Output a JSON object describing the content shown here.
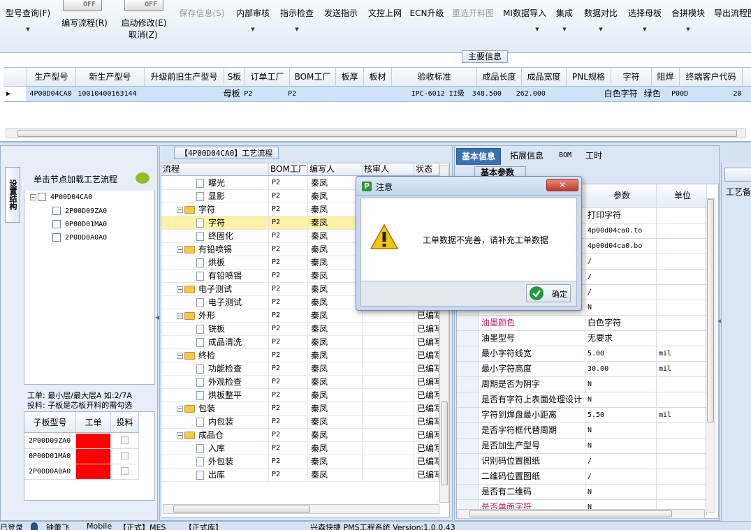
{
  "toolbar": {
    "buttons": [
      {
        "label": "型号查询(F)",
        "dropdown": true
      },
      {
        "label": "编写流程(R)"
      },
      {
        "label": "启动修改(E)"
      },
      {
        "label": "保存信息(S)",
        "disabled": true
      },
      {
        "label": "内部审核",
        "dropdown": true
      },
      {
        "label": "指示检查",
        "dropdown": true
      },
      {
        "label": "发送指示"
      },
      {
        "label": "文控上网"
      },
      {
        "label": "ECN升级"
      },
      {
        "label": "重选开料图",
        "disabled": true
      },
      {
        "label": "MI数据导入",
        "dropdown": true
      },
      {
        "label": "集成",
        "dropdown": true
      },
      {
        "label": "数据对比",
        "dropdown": true
      },
      {
        "label": "选择母板",
        "dropdown": true
      },
      {
        "label": "合拼模块",
        "dropdown": true
      },
      {
        "label": "导出流程图"
      }
    ],
    "toggle_off": "OFF",
    "cancel_label": "取消(Z)"
  },
  "main_info": {
    "caption": "主要信息",
    "columns": [
      "生产型号",
      "新生产型号",
      "升级前旧生产型号",
      "S板",
      "订单工厂",
      "BOM工厂",
      "板厚",
      "板材",
      "验收标准",
      "成品长度",
      "成品宽度",
      "PNL规格",
      "字符",
      "阻焊",
      "终端客户代码"
    ],
    "row": [
      "4P00D04CA0",
      "10010400163144",
      "",
      "母板",
      "P2",
      "P2",
      "",
      "",
      "IPC-6012 II级",
      "348.500",
      "262.000",
      "",
      "白色字符",
      "绿色",
      "P00D"
    ],
    "row_extra": "20"
  },
  "left": {
    "vtab_label": "设置结构",
    "tree_header": "单击节点加载工艺流程",
    "tree": {
      "root": "4P00D04CA0",
      "children": [
        "2P00D09ZA0",
        "0P00D01MA0",
        "2P00D0A0A0"
      ]
    },
    "note1": "工单: 最小层/最大层A 如:2/7A",
    "note2": "投料: 子板是芯板开料的需勾选",
    "sub_grid": {
      "headers": [
        "子板型号",
        "工单",
        "投料"
      ],
      "rows": [
        "2P00D09ZA0",
        "0P00D01MA0",
        "2P00D0A0A0"
      ]
    }
  },
  "process": {
    "caption": "【4P00D04CA0】工艺流程",
    "headers": [
      "流程",
      "BOM工厂",
      "编写人",
      "核审人",
      "状态"
    ],
    "rows": [
      {
        "name": "曝光",
        "level": 2,
        "bom": "P2",
        "writer": "秦凤",
        "status": ""
      },
      {
        "name": "显影",
        "level": 2,
        "bom": "P2",
        "writer": "秦凤",
        "status": ""
      },
      {
        "name": "字符",
        "level": 1,
        "bom": "P2",
        "writer": "秦凤",
        "status": ""
      },
      {
        "name": "字符",
        "level": 2,
        "bom": "P2",
        "writer": "秦凤",
        "status": "",
        "selected": true
      },
      {
        "name": "终固化",
        "level": 2,
        "bom": "P2",
        "writer": "秦凤",
        "status": ""
      },
      {
        "name": "有铅喷锡",
        "level": 1,
        "bom": "P2",
        "writer": "秦凤",
        "status": ""
      },
      {
        "name": "烘板",
        "level": 2,
        "bom": "P2",
        "writer": "秦凤",
        "status": ""
      },
      {
        "name": "有铅喷锡",
        "level": 2,
        "bom": "P2",
        "writer": "秦凤",
        "status": ""
      },
      {
        "name": "电子测试",
        "level": 1,
        "bom": "P2",
        "writer": "秦凤",
        "status": ""
      },
      {
        "name": "电子测试",
        "level": 2,
        "bom": "P2",
        "writer": "秦凤",
        "status": ""
      },
      {
        "name": "外形",
        "level": 1,
        "bom": "P2",
        "writer": "秦凤",
        "status": "已编写"
      },
      {
        "name": "铣板",
        "level": 2,
        "bom": "P2",
        "writer": "秦凤",
        "status": "已编写"
      },
      {
        "name": "成品清洗",
        "level": 2,
        "bom": "P2",
        "writer": "秦凤",
        "status": "已编写"
      },
      {
        "name": "终检",
        "level": 1,
        "bom": "P2",
        "writer": "秦凤",
        "status": "已编写"
      },
      {
        "name": "功能检查",
        "level": 2,
        "bom": "P2",
        "writer": "秦凤",
        "status": "已编写"
      },
      {
        "name": "外观检查",
        "level": 2,
        "bom": "P2",
        "writer": "秦凤",
        "status": "已编写"
      },
      {
        "name": "烘板整平",
        "level": 2,
        "bom": "P2",
        "writer": "秦凤",
        "status": "已编写"
      },
      {
        "name": "包装",
        "level": 1,
        "bom": "P2",
        "writer": "秦凤",
        "status": "已编写"
      },
      {
        "name": "内包装",
        "level": 2,
        "bom": "P2",
        "writer": "秦凤",
        "status": "已编写"
      },
      {
        "name": "成品仓",
        "level": 1,
        "bom": "P2",
        "writer": "秦凤",
        "status": "已编写"
      },
      {
        "name": "入库",
        "level": 2,
        "bom": "P2",
        "writer": "秦凤",
        "status": "已编写"
      },
      {
        "name": "外包装",
        "level": 2,
        "bom": "P2",
        "writer": "秦凤",
        "status": "已编写"
      },
      {
        "name": "出库",
        "level": 2,
        "bom": "P2",
        "writer": "秦凤",
        "status": "已编写"
      }
    ]
  },
  "right": {
    "tabs": [
      "基本信息",
      "拓展信息",
      "BOM",
      "工时"
    ],
    "sub_tab": "基本参数",
    "col_param": "参数",
    "col_unit": "单位",
    "far_right_label": "工艺备",
    "rows": [
      {
        "name": "",
        "value": "打印字符",
        "unit": ""
      },
      {
        "name": "",
        "value": "4p00d04ca0.to",
        "unit": ""
      },
      {
        "name": "",
        "value": "4p00d04ca0.bo",
        "unit": ""
      },
      {
        "name": "",
        "value": "/",
        "unit": ""
      },
      {
        "name": "",
        "value": "/",
        "unit": ""
      },
      {
        "name": "",
        "value": "/",
        "unit": ""
      },
      {
        "name": "",
        "value": "N",
        "unit": ""
      },
      {
        "name": "油墨颜色",
        "value": "白色字符",
        "unit": "",
        "highlight": true
      },
      {
        "name": "油墨型号",
        "value": "无要求",
        "unit": ""
      },
      {
        "name": "最小字符线宽",
        "value": "5.00",
        "unit": "mil"
      },
      {
        "name": "最小字符高度",
        "value": "30.00",
        "unit": "mil"
      },
      {
        "name": "周期是否为阴字",
        "value": "N",
        "unit": ""
      },
      {
        "name": "是否有字符上表面处理设计",
        "value": "N",
        "unit": ""
      },
      {
        "name": "字符到焊盘最小距离",
        "value": "5.50",
        "unit": "mil"
      },
      {
        "name": "是否字符框代替周期",
        "value": "N",
        "unit": ""
      },
      {
        "name": "是否加生产型号",
        "value": "N",
        "unit": ""
      },
      {
        "name": "识别码位置图纸",
        "value": "/",
        "unit": ""
      },
      {
        "name": "二维码位置图纸",
        "value": "/",
        "unit": ""
      },
      {
        "name": "是否有二维码",
        "value": "N",
        "unit": ""
      },
      {
        "name": "是否单面字符",
        "value": "N",
        "unit": "",
        "highlight": true
      }
    ]
  },
  "dialog": {
    "title": "注意",
    "message": "工单数据不完善，请补充工单数据",
    "ok_label": "确定"
  },
  "status_bar": {
    "segments": [
      "已登录",
      "钟蕾飞",
      "Mobile",
      "【正式】MES",
      "【正式库】",
      "兴森快捷 PMS工程系统 Version:1.0.0.43"
    ]
  },
  "colors": {
    "accent": "#3c70b4",
    "selection": "#cfe3f8",
    "highlight": "#fff2a8",
    "red": "#ff0000",
    "magenta": "#c0186b"
  }
}
